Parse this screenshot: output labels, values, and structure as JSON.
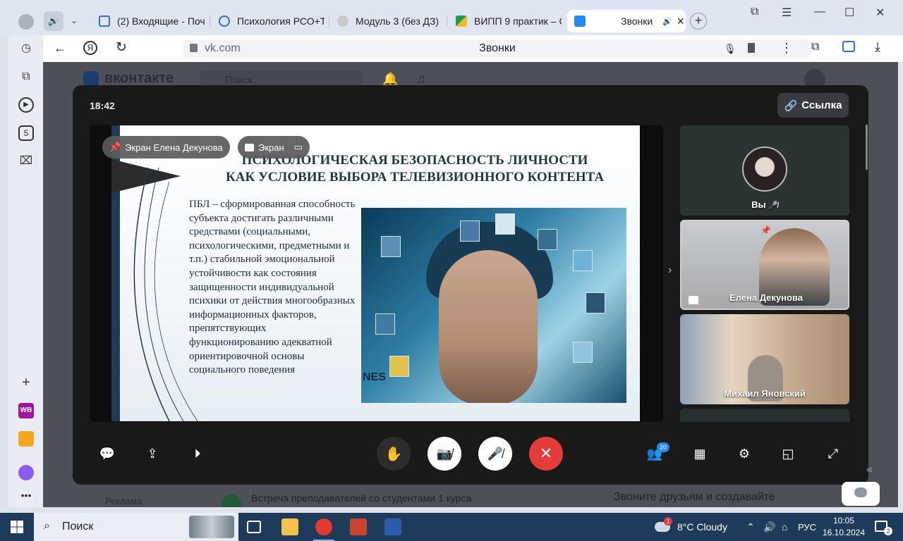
{
  "browser": {
    "tabs": [
      {
        "label": "(2) Входящие - Почт",
        "color": "#2a6fd6"
      },
      {
        "label": "Психология РСО+ТЕ",
        "color": "#2a6fd6"
      },
      {
        "label": "Модуль 3 (без ДЗ)",
        "color": "#9a9a9a"
      },
      {
        "label": "ВИПП 9 практик – G",
        "color": "#1a9e4a"
      },
      {
        "label": "Звонки",
        "color": "#2787f5",
        "active": true
      }
    ],
    "address_host": "vk.com",
    "page_title": "Звонки"
  },
  "sidebar": {
    "history_icon": "clock-icon",
    "badge_number": "5",
    "wb_label": "WB"
  },
  "vk": {
    "logo_text": "вконтакте",
    "search_placeholder": "Поиск"
  },
  "call": {
    "timer": "18:42",
    "link_button": "Ссылка",
    "chip_presenter": "Экран Елена Декунова",
    "chip_screen": "Экран",
    "slide": {
      "title_line1": "ПСИХОЛОГИЧЕСКАЯ БЕЗОПАСНОСТЬ ЛИЧНОСТИ",
      "title_line2": "КАК УСЛОВИЕ ВЫБОРА ТЕЛЕВИЗИОННОГО КОНТЕНТА",
      "body": "ПБЛ – сформированная способность субъекта достигать различными средствами (социальными, психологическими, предметными и т.п.) стабильной эмоциональной устойчивости как состояния защищенности индивидуальной психики от действия многообразных информационных факторов, препятствующих функционированию адекватной ориентировочной основы социального поведения",
      "image_text": "NES"
    },
    "participants": [
      {
        "name": "Вы"
      },
      {
        "name": "Елена Декунова"
      },
      {
        "name": "Михаил Яновский"
      }
    ],
    "participants_count": "20"
  },
  "page_below": {
    "ads_label": "Реклама",
    "meeting_label": "Встреча преподавателей со студентами 1 курса",
    "promo_text": "Звоните друзьям и создавайте"
  },
  "taskbar": {
    "search_label": "Поиск",
    "weather": "8°C  Cloudy",
    "lang": "РУС",
    "time": "10:05",
    "date": "16.10.2024",
    "notif_count": "2",
    "weather_badge": "1"
  }
}
